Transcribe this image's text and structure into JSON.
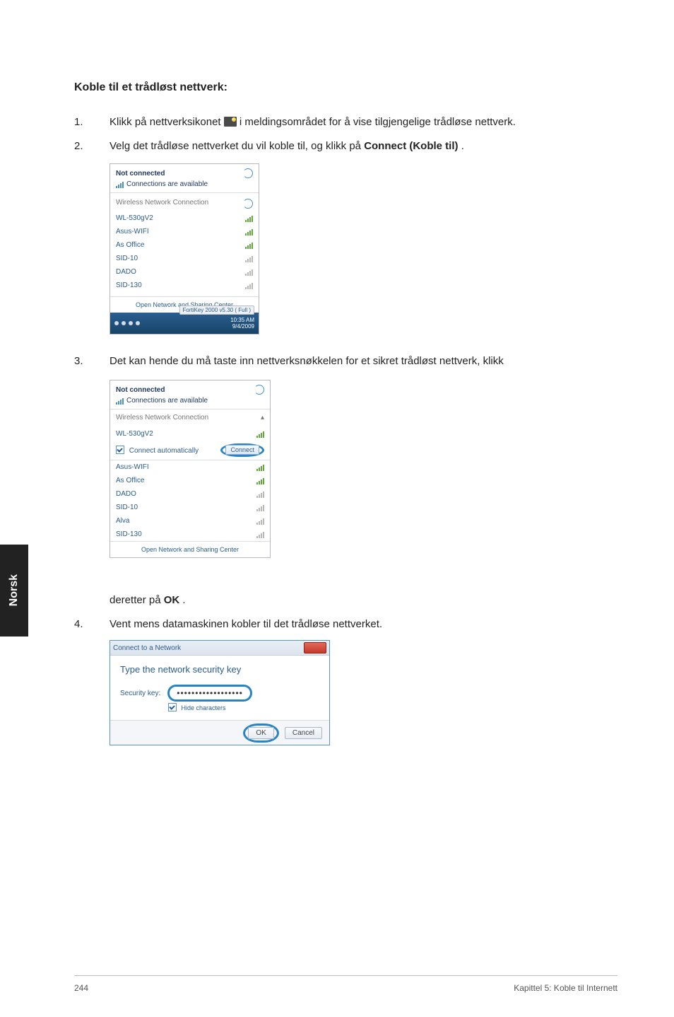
{
  "heading": "Koble til et trådløst nettverk:",
  "step1": {
    "num": "1.",
    "pre": "Klikk på nettverksikonet ",
    "post": " i meldingsområdet for å vise tilgjengelige trådløse nettverk."
  },
  "step2": {
    "num": "2.",
    "pre": "Velg det trådløse nettverket du vil koble til, og klikk på ",
    "bold": "Connect (Koble til)",
    "post": "."
  },
  "popup1": {
    "title": "Not connected",
    "sub": "Connections are available",
    "category": "Wireless Network Connection",
    "networks": [
      {
        "name": "WL-530gV2",
        "strength": "green"
      },
      {
        "name": "Asus-WIFI",
        "strength": "green"
      },
      {
        "name": "As Office",
        "strength": "green"
      },
      {
        "name": "SID-10",
        "strength": "weak"
      },
      {
        "name": "DADO",
        "strength": "weak"
      },
      {
        "name": "SID-130",
        "strength": "weak"
      }
    ],
    "link": "Open Network and Sharing Center",
    "fort": "FortiKey 2000 v5.30 ( Full )",
    "time": "10:35 AM",
    "date": "9/4/2009"
  },
  "step3": {
    "num": "3.",
    "text": "Det kan hende du må taste inn nettverksnøkkelen for et sikret trådløst nettverk, klikk"
  },
  "popup2": {
    "title": "Not connected",
    "sub": "Connections are available",
    "category": "Wireless Network Connection",
    "top_network": "WL-530gV2",
    "auto": "Connect automatically",
    "connect": "Connect",
    "networks": [
      {
        "name": "Asus-WIFI",
        "strength": "green"
      },
      {
        "name": "As Office",
        "strength": "green"
      },
      {
        "name": "DADO",
        "strength": "weak"
      },
      {
        "name": "SID-10",
        "strength": "weak"
      },
      {
        "name": "Alva",
        "strength": "weak"
      },
      {
        "name": "SID-130",
        "strength": "weak"
      }
    ],
    "link": "Open Network and Sharing Center"
  },
  "step3b": {
    "pre": "deretter på ",
    "bold": "OK",
    "post": "."
  },
  "step4": {
    "num": "4.",
    "text": "Vent mens datamaskinen kobler til det trådløse nettverket."
  },
  "dialog": {
    "title": "Connect to a Network",
    "heading": "Type the network security key",
    "label": "Security key:",
    "value": "••••••••••••••••••",
    "hide": "Hide characters",
    "ok": "OK",
    "cancel": "Cancel"
  },
  "side_tab": "Norsk",
  "footer": {
    "page": "244",
    "chapter": "Kapittel 5: Koble til Internett"
  }
}
